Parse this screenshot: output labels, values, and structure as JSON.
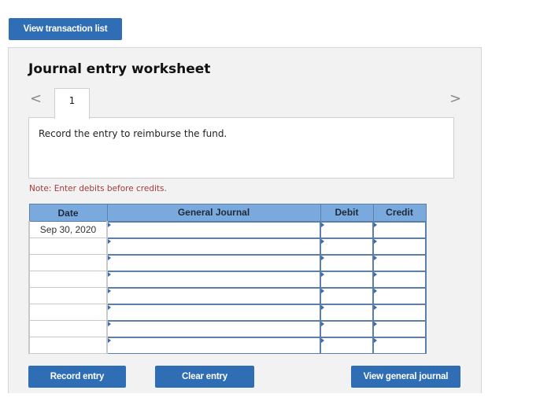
{
  "top_button": {
    "label": "View transaction list"
  },
  "worksheet": {
    "title": "Journal entry worksheet",
    "nav": {
      "prev_icon": "chevron-left-icon",
      "next_icon": "chevron-right-icon",
      "prev_glyph": "<",
      "next_glyph": ">"
    },
    "tabs": [
      {
        "label": "1",
        "active": true
      }
    ],
    "description": "Record the entry to reimburse the fund.",
    "note": "Note: Enter debits before credits."
  },
  "table": {
    "headers": {
      "date": "Date",
      "general_journal": "General Journal",
      "debit": "Debit",
      "credit": "Credit"
    },
    "rows": [
      {
        "date": "Sep 30, 2020",
        "account": "",
        "debit": "",
        "credit": ""
      },
      {
        "date": "",
        "account": "",
        "debit": "",
        "credit": ""
      },
      {
        "date": "",
        "account": "",
        "debit": "",
        "credit": ""
      },
      {
        "date": "",
        "account": "",
        "debit": "",
        "credit": ""
      },
      {
        "date": "",
        "account": "",
        "debit": "",
        "credit": ""
      },
      {
        "date": "",
        "account": "",
        "debit": "",
        "credit": ""
      },
      {
        "date": "",
        "account": "",
        "debit": "",
        "credit": ""
      },
      {
        "date": "",
        "account": "",
        "debit": "",
        "credit": ""
      }
    ]
  },
  "actions": {
    "record": "Record entry",
    "clear": "Clear entry",
    "view_journal": "View general journal"
  },
  "colors": {
    "button": "#2f6eb5",
    "header": "#7aa9de",
    "note": "#a53a3a",
    "panel": "#f2f2f2"
  }
}
